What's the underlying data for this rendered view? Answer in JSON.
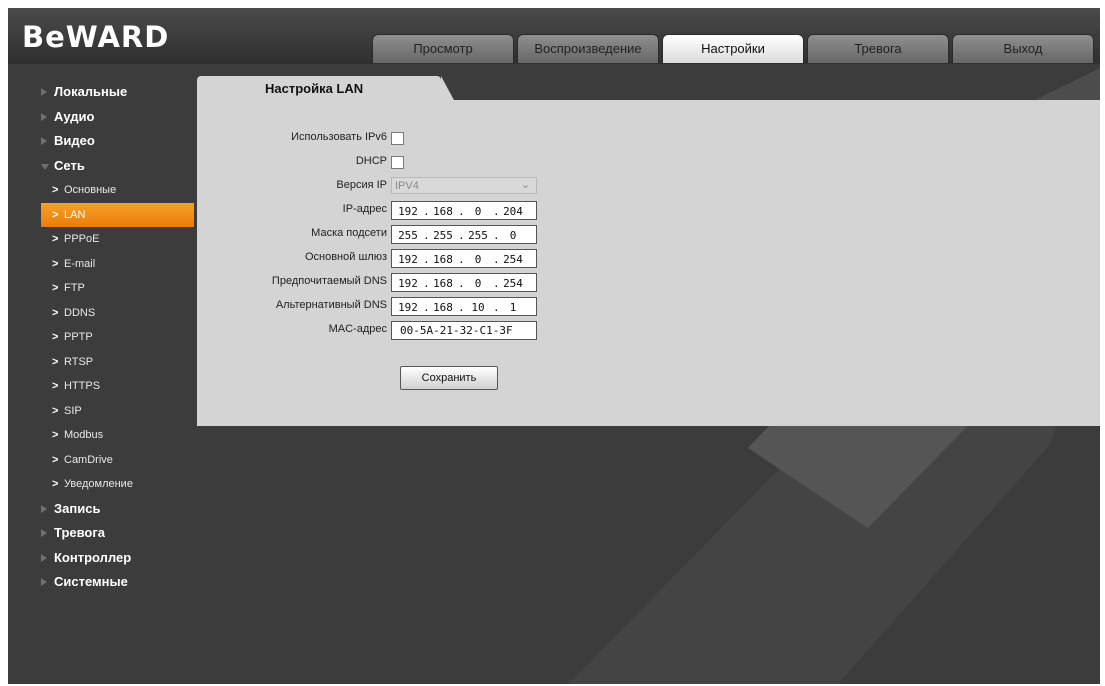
{
  "header": {
    "logo": "BeWARD",
    "tabs": [
      {
        "label": "Просмотр",
        "active": false
      },
      {
        "label": "Воспроизведение",
        "active": false
      },
      {
        "label": "Настройки",
        "active": true
      },
      {
        "label": "Тревога",
        "active": false
      },
      {
        "label": "Выход",
        "active": false
      }
    ]
  },
  "sidebar": {
    "categories_top": [
      {
        "label": "Локальные"
      },
      {
        "label": "Аудио"
      },
      {
        "label": "Видео"
      },
      {
        "label": "Сеть",
        "expanded": true
      }
    ],
    "network_items": [
      {
        "label": "Основные"
      },
      {
        "label": "LAN",
        "active": true
      },
      {
        "label": "PPPoE"
      },
      {
        "label": "E-mail"
      },
      {
        "label": "FTP"
      },
      {
        "label": "DDNS"
      },
      {
        "label": "PPTP"
      },
      {
        "label": "RTSP"
      },
      {
        "label": "HTTPS"
      },
      {
        "label": "SIP"
      },
      {
        "label": "Modbus"
      },
      {
        "label": "CamDrive"
      },
      {
        "label": "Уведомление"
      }
    ],
    "categories_bottom": [
      {
        "label": "Запись"
      },
      {
        "label": "Тревога"
      },
      {
        "label": "Контроллер"
      },
      {
        "label": "Системные"
      }
    ]
  },
  "content": {
    "tab_label": "Настройка LAN",
    "fields": {
      "ipv6": {
        "label": "Использовать IPv6",
        "checked": false
      },
      "dhcp": {
        "label": "DHCP",
        "checked": false
      },
      "ip_version": {
        "label": "Версия IP",
        "value": "IPV4"
      },
      "ip_address": {
        "label": "IP-адрес",
        "octets": [
          "192",
          "168",
          "0",
          "204"
        ]
      },
      "subnet_mask": {
        "label": "Маска подсети",
        "octets": [
          "255",
          "255",
          "255",
          "0"
        ]
      },
      "gateway": {
        "label": "Основной шлюз",
        "octets": [
          "192",
          "168",
          "0",
          "254"
        ]
      },
      "preferred_dns": {
        "label": "Предпочитаемый DNS",
        "octets": [
          "192",
          "168",
          "0",
          "254"
        ]
      },
      "alternate_dns": {
        "label": "Альтернативный DNS",
        "octets": [
          "192",
          "168",
          "10",
          "1"
        ]
      },
      "mac_address": {
        "label": "MAC-адрес",
        "value": "00-5A-21-32-C1-3F"
      }
    },
    "save_label": "Сохранить"
  },
  "colors": {
    "background": "#3c3c3c",
    "panel": "#d4d4d4",
    "active_item": "#f29016",
    "active_tab": "#ffffff"
  }
}
